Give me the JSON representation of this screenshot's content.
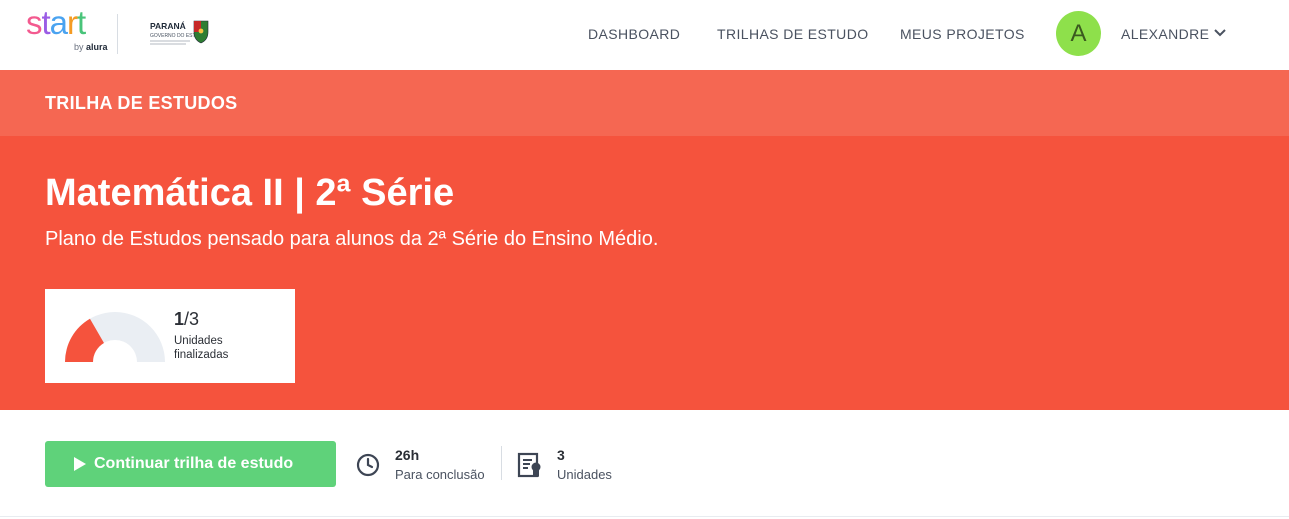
{
  "brand": {
    "logo_text": "start",
    "by_prefix": "by",
    "by_brand": "alura",
    "partner_name": "PARANÁ",
    "partner_subtitle": "GOVERNO DO ESTADO"
  },
  "nav": {
    "links": [
      "DASHBOARD",
      "TRILHAS DE ESTUDO",
      "MEUS PROJETOS"
    ],
    "user": {
      "avatar_initial": "A",
      "name": "ALEXANDRE"
    }
  },
  "hero": {
    "section_label": "TRILHA DE ESTUDOS",
    "title": "Matemática II | 2ª Série",
    "subtitle": "Plano de Estudos pensado para alunos da 2ª Série do Ensino Médio."
  },
  "progress": {
    "completed": "1",
    "total": "/3",
    "label": "Unidades finalizadas",
    "fraction": 0.333
  },
  "actions": {
    "continue_label": "Continuar trilha de estudo"
  },
  "stats": {
    "duration_value": "26h",
    "duration_caption": "Para conclusão",
    "units_value": "3",
    "units_caption": "Unidades"
  },
  "colors": {
    "hero_bar": "#f56752",
    "hero_main": "#f5533d",
    "button_green": "#5fd27a",
    "avatar_green": "#8ee04b",
    "gauge_fill": "#f5533d",
    "gauge_track": "#eaeef3"
  },
  "icons": [
    "start-logo",
    "parana-logo",
    "chevron-down-icon",
    "gauge-chart",
    "play-icon",
    "clock-icon",
    "units-icon"
  ]
}
